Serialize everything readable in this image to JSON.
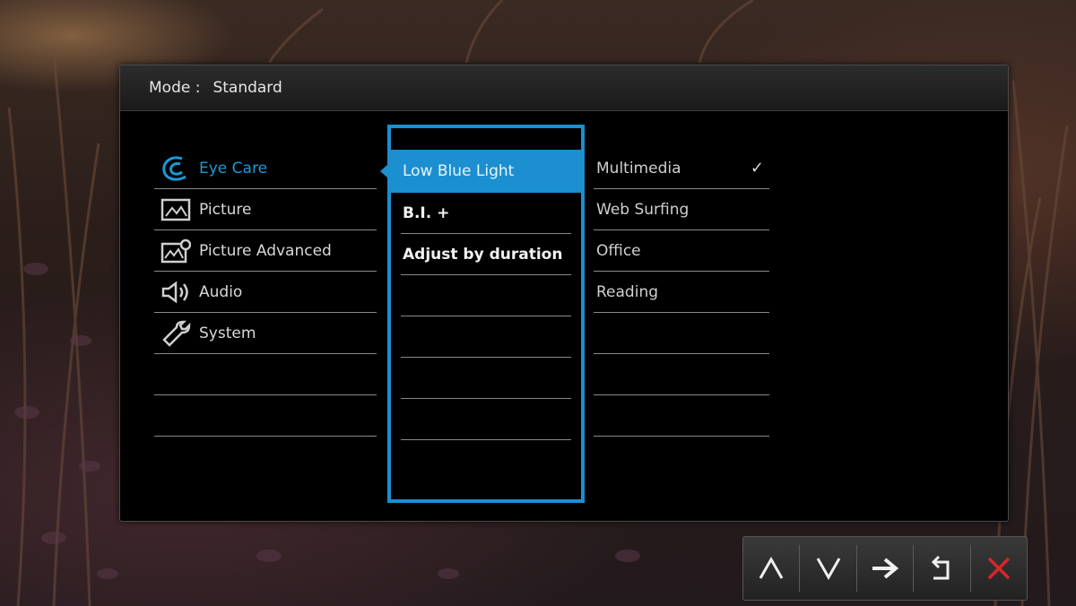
{
  "header": {
    "mode_label": "Mode :",
    "mode_value": "Standard"
  },
  "main_menu": {
    "items": [
      {
        "label": "Eye Care",
        "icon": "eye-care-icon",
        "active": true
      },
      {
        "label": "Picture",
        "icon": "picture-icon"
      },
      {
        "label": "Picture Advanced",
        "icon": "picture-advanced-icon"
      },
      {
        "label": "Audio",
        "icon": "speaker-icon"
      },
      {
        "label": "System",
        "icon": "wrench-icon"
      }
    ]
  },
  "sub_menu": {
    "items": [
      {
        "label": "Low Blue Light",
        "selected": true
      },
      {
        "label": "B.I. +"
      },
      {
        "label": "Adjust by duration"
      }
    ]
  },
  "options": {
    "items": [
      {
        "label": "Multimedia",
        "checked": true
      },
      {
        "label": "Web Surfing"
      },
      {
        "label": "Office"
      },
      {
        "label": "Reading"
      }
    ]
  },
  "keys": [
    {
      "icon": "up-icon",
      "glyph": "Λ"
    },
    {
      "icon": "down-icon",
      "glyph": "V"
    },
    {
      "icon": "right-arrow-icon",
      "glyph": "➔"
    },
    {
      "icon": "back-icon",
      "glyph": "↶"
    },
    {
      "icon": "close-icon",
      "glyph": "✕"
    }
  ],
  "colors": {
    "accent": "#1b8fd0",
    "close": "#d8262b",
    "background": "#000000"
  }
}
